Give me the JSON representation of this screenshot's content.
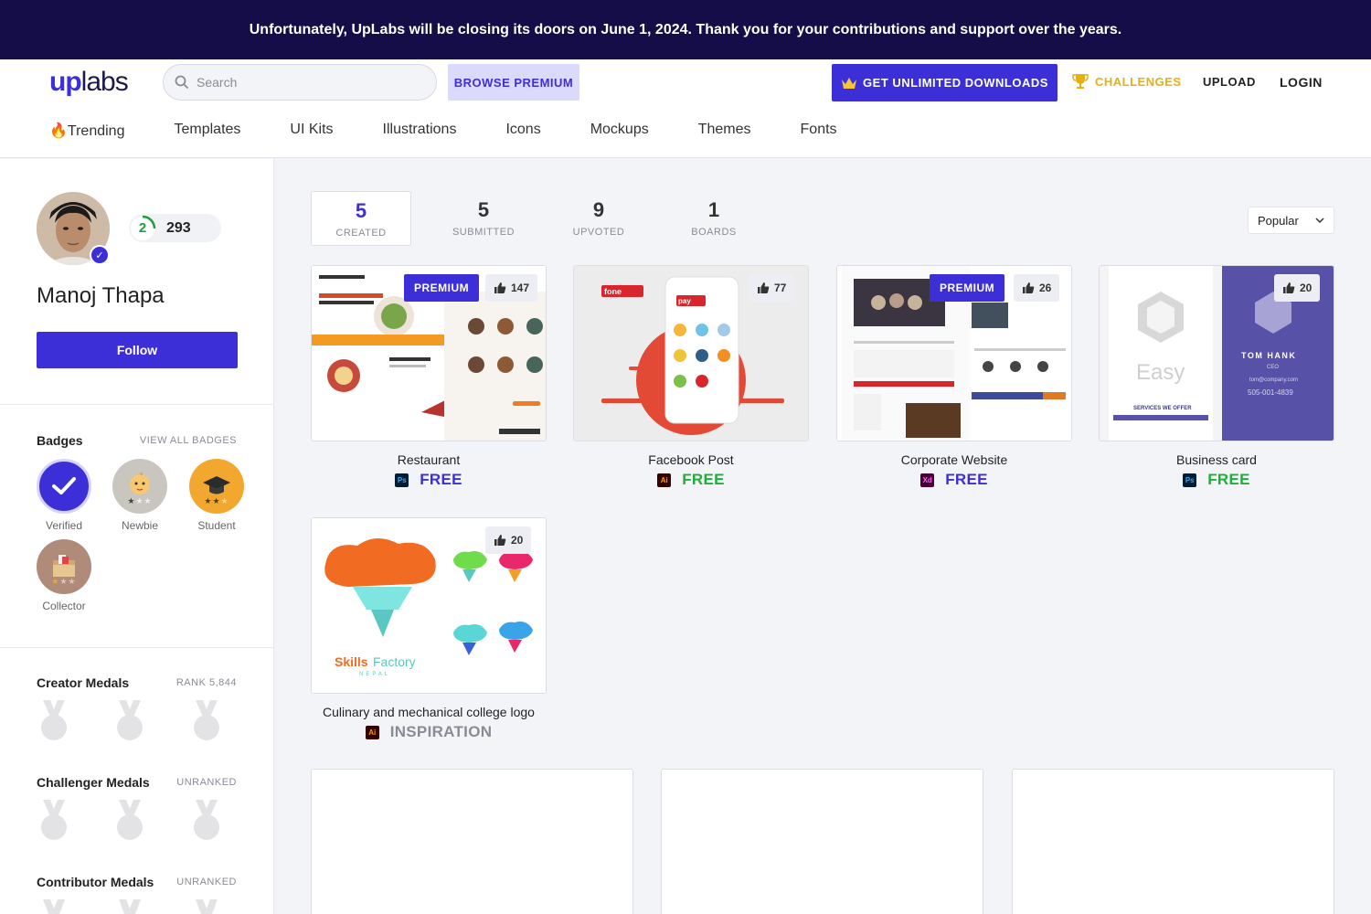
{
  "banner": {
    "text": "Unfortunately, UpLabs will be closing its doors on June 1, 2024. Thank you for your contributions and support over the years."
  },
  "header": {
    "logo_up": "up",
    "logo_labs": "labs",
    "search_placeholder": "Search",
    "browse_premium": "BROWSE PREMIUM",
    "unlimited_downloads": "GET UNLIMITED DOWNLOADS",
    "challenges": "CHALLENGES",
    "upload": "UPLOAD",
    "login": "LOGIN",
    "nav": [
      "Trending",
      "Templates",
      "UI Kits",
      "Illustrations",
      "Icons",
      "Mockups",
      "Themes",
      "Fonts"
    ],
    "accent": "#3d2fd8"
  },
  "profile": {
    "level": "2",
    "points": "293",
    "name": "Manoj Thapa",
    "follow": "Follow",
    "badges_title": "Badges",
    "view_all_badges": "VIEW ALL BADGES",
    "badges": [
      {
        "label": "Verified",
        "icon": "checkmark-icon"
      },
      {
        "label": "Newbie",
        "icon": "baby-icon"
      },
      {
        "label": "Student",
        "icon": "graduation-cap-icon"
      },
      {
        "label": "Collector",
        "icon": "box-icon"
      }
    ],
    "medal_sections": [
      {
        "title": "Creator Medals",
        "meta": "RANK 5,844"
      },
      {
        "title": "Challenger Medals",
        "meta": "UNRANKED"
      },
      {
        "title": "Contributor Medals",
        "meta": "UNRANKED"
      }
    ]
  },
  "stats": [
    {
      "num": "5",
      "label": "CREATED"
    },
    {
      "num": "5",
      "label": "SUBMITTED"
    },
    {
      "num": "9",
      "label": "UPVOTED"
    },
    {
      "num": "1",
      "label": "BOARDS"
    }
  ],
  "sort": {
    "selected": "Popular"
  },
  "cards": [
    {
      "title": "Restaurant",
      "app": "Ps",
      "price": "FREE",
      "likes": "147",
      "premium": "PREMIUM"
    },
    {
      "title": "Facebook Post",
      "app": "Ai",
      "price": "FREE",
      "likes": "77"
    },
    {
      "title": "Corporate Website",
      "app": "Xd",
      "price": "FREE",
      "likes": "26",
      "premium": "PREMIUM"
    },
    {
      "title": "Business card",
      "app": "Ps",
      "price": "FREE",
      "likes": "20"
    },
    {
      "title": "Culinary and mechanical college logo",
      "app": "Ai",
      "price": "INSPIRATION",
      "likes": "20"
    }
  ],
  "thumb_text": {
    "fonepay": "fone",
    "fonepay2": "pay",
    "easy": "Easy",
    "tom_hank": "TOM HANK",
    "ceo": "CEO",
    "email": "tom@company.com",
    "phone": "505-001-4839",
    "services": "SERVICES WE OFFER",
    "skills": "Skills",
    "factory": "Factory",
    "nepal": "NEPAL"
  },
  "colors": {
    "free": "#1fae3a",
    "inspiration": "#8a8b95",
    "banner_bg": "#140d47"
  }
}
